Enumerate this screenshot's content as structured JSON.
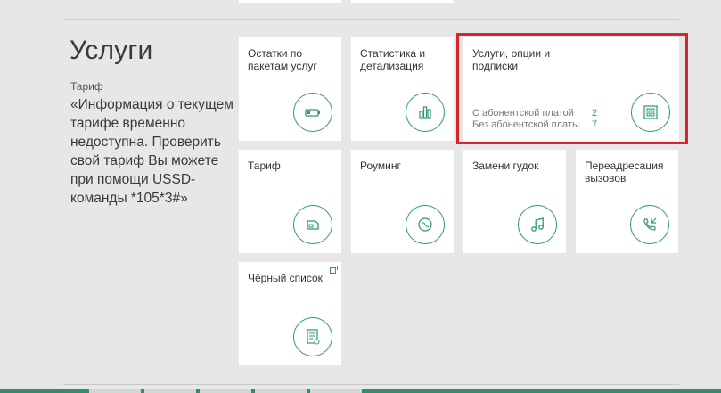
{
  "section": {
    "title": "Услуги",
    "tariff_label": "Тариф",
    "tariff_info": "«Информация о текущем тарифе временно недоступна. Проверить свой тариф Вы можете при помощи USSD-команды *105*3#»"
  },
  "tiles": {
    "balances": {
      "title": "Остатки по пакетам услуг",
      "icon": "battery-icon"
    },
    "statistics": {
      "title": "Статистика и детализация",
      "icon": "bar-chart-icon"
    },
    "services": {
      "title": "Услуги, опции и подписки",
      "icon": "grid-icon",
      "paid_label": "С абонентской платой",
      "paid_count": "2",
      "free_label": "Без абонентской платы",
      "free_count": "7"
    },
    "tariff": {
      "title": "Тариф",
      "icon": "sim-card-icon"
    },
    "roaming": {
      "title": "Роуминг",
      "icon": "globe-icon"
    },
    "ringback": {
      "title": "Замени гудок",
      "icon": "music-note-icon"
    },
    "forwarding": {
      "title": "Переадресация вызовов",
      "icon": "phone-forward-icon"
    },
    "blacklist": {
      "title": "Чёрный список",
      "icon": "document-list-icon"
    }
  },
  "colors": {
    "accent": "#2e9a6a",
    "highlight": "#d9262c",
    "background": "#e7e7e7",
    "tile": "#ffffff"
  }
}
